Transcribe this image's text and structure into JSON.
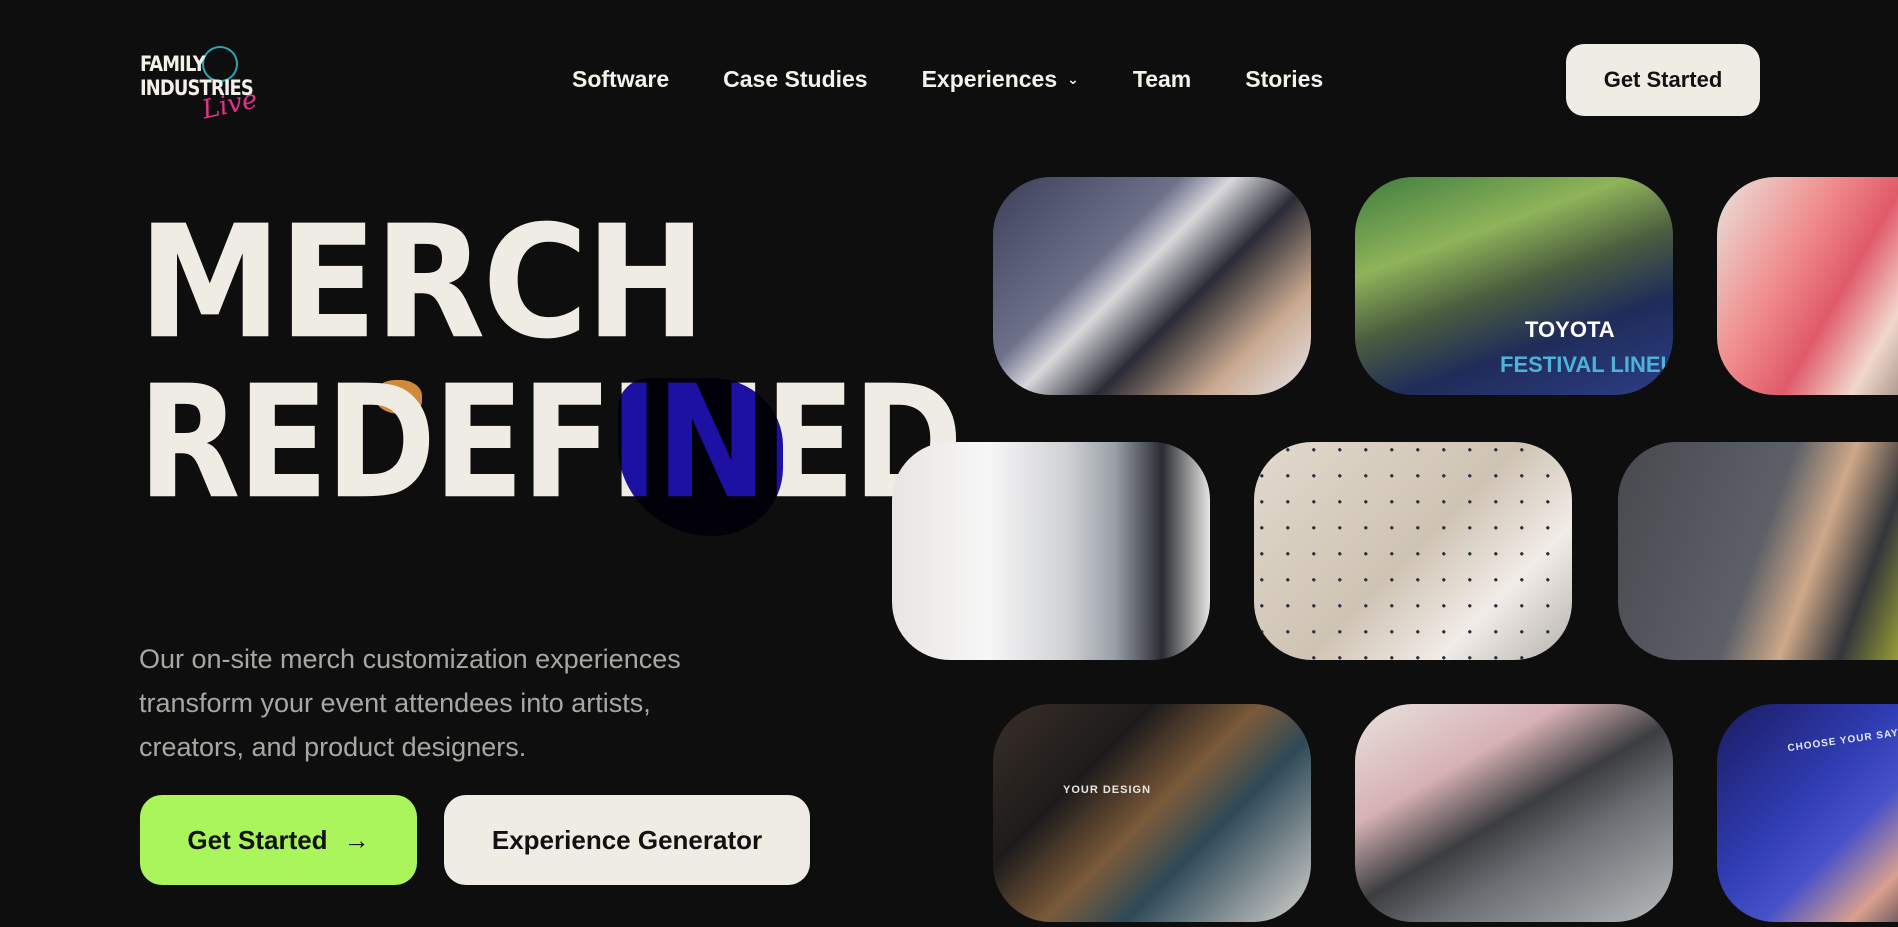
{
  "brand": {
    "line1": "FAMILY",
    "line2": "INDUSTRIES",
    "script": "Live"
  },
  "nav": {
    "items": [
      {
        "label": "Software"
      },
      {
        "label": "Case Studies"
      },
      {
        "label": "Experiences",
        "has_dropdown": true
      },
      {
        "label": "Team"
      },
      {
        "label": "Stories"
      }
    ],
    "cta": "Get Started"
  },
  "hero": {
    "headline_line1": "MERCH",
    "headline_line2": "REDEFINED",
    "description": "Our on-site merch customization experiences transform your event attendees into artists, creators, and product designers.",
    "primary_button": "Get Started",
    "secondary_button": "Experience Generator"
  },
  "tiles": [
    {
      "name": "photo-printing-artist"
    },
    {
      "name": "photo-toyota-festival",
      "caption_line1": "TOYOTA",
      "caption_line2": "FESTIVAL LINEU"
    },
    {
      "name": "photo-pink-bag"
    },
    {
      "name": "photo-baseball-jersey"
    },
    {
      "name": "photo-pegboard-booth"
    },
    {
      "name": "photo-press-operator"
    },
    {
      "name": "photo-design-kiosk",
      "caption": "YOUR DESIGN"
    },
    {
      "name": "photo-heat-press"
    },
    {
      "name": "photo-choose-your-saying",
      "caption": "CHOOSE YOUR SAYING"
    }
  ],
  "colors": {
    "background": "#0e0e0e",
    "accent_green": "#a9f55b",
    "cream": "#efece4",
    "blue_blob": "#1d12b6",
    "orange_blob": "#d08a3a"
  }
}
